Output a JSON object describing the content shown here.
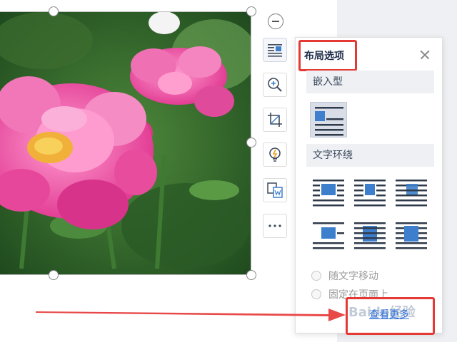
{
  "panel": {
    "title": "布局选项",
    "inline_section": "嵌入型",
    "wrap_section": "文字环绕",
    "options": [
      {
        "label": "随文字移动"
      },
      {
        "label": "固定在页面上"
      }
    ],
    "more_link": "查看更多",
    "watermark": "Baidu经验"
  },
  "colors": {
    "accent": "#2f6fd6",
    "highlight_red": "#e53935",
    "icon_blue": "#3d7fcc"
  },
  "icons": {
    "toolbar": [
      "minus-icon",
      "layout-options-icon",
      "zoom-in-icon",
      "crop-icon",
      "idea-icon",
      "convert-icon",
      "more-icon"
    ]
  }
}
